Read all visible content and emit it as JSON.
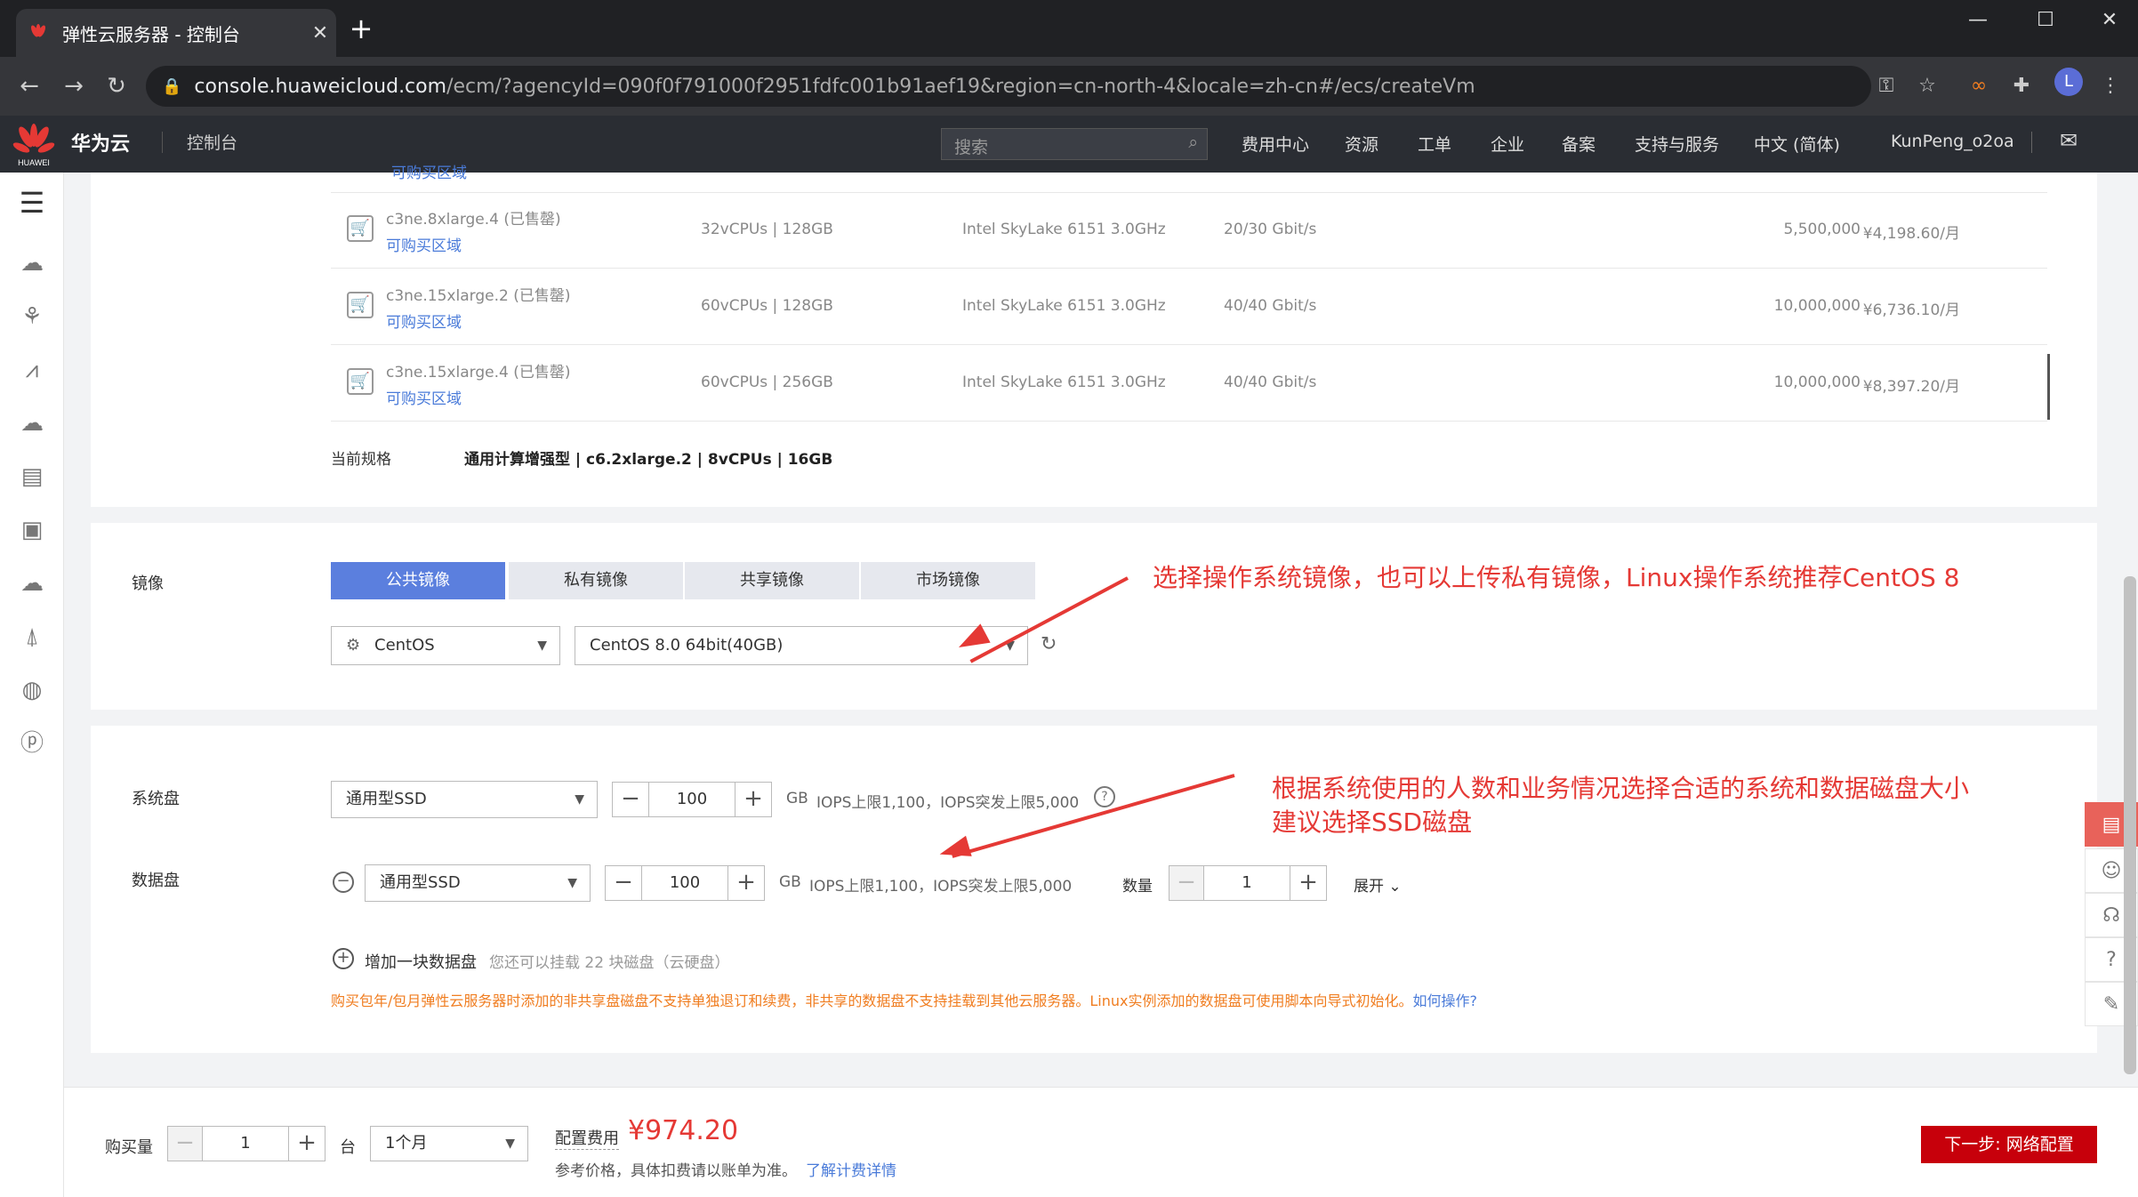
{
  "browser": {
    "tab_title": "弹性云服务器 - 控制台",
    "url_host": "console.huaweicloud.com",
    "url_path": "/ecm/?agencyId=090f0f791000f2951fdfc001b91aef19&region=cn-north-4&locale=zh-cn#/ecs/createVm",
    "avatar": "L"
  },
  "header": {
    "brand": "华为云",
    "logo_text": "HUAWEI",
    "console": "控制台",
    "search_placeholder": "搜索",
    "nav": [
      "费用中心",
      "资源",
      "工单",
      "企业",
      "备案",
      "支持与服务",
      "中文 (简体)",
      "KunPeng_o2oa"
    ]
  },
  "flavors": {
    "rows": [
      {
        "name": "c3ne.8xlarge.4 (已售罄)",
        "link": "可购买区域",
        "cpu_mem": "32vCPUs | 128GB",
        "cpu": "Intel SkyLake 6151 3.0GHz",
        "net": "20/30 Gbit/s",
        "pps": "5,500,000",
        "price": "¥4,198.60/月"
      },
      {
        "name": "c3ne.15xlarge.2 (已售罄)",
        "link": "可购买区域",
        "cpu_mem": "60vCPUs | 128GB",
        "cpu": "Intel SkyLake 6151 3.0GHz",
        "net": "40/40 Gbit/s",
        "pps": "10,000,000",
        "price": "¥6,736.10/月"
      },
      {
        "name": "c3ne.15xlarge.4 (已售罄)",
        "link": "可购买区域",
        "cpu_mem": "60vCPUs | 256GB",
        "cpu": "Intel SkyLake 6151 3.0GHz",
        "net": "40/40 Gbit/s",
        "pps": "10,000,000",
        "price": "¥8,397.20/月"
      }
    ],
    "partial_link": "可购买区域",
    "current_label": "当前规格",
    "current_value": "通用计算增强型 | c6.2xlarge.2 | 8vCPUs | 16GB"
  },
  "image": {
    "label": "镜像",
    "tabs": [
      "公共镜像",
      "私有镜像",
      "共享镜像",
      "市场镜像"
    ],
    "os": "CentOS",
    "version": "CentOS 8.0 64bit(40GB)",
    "note": "选择操作系统镜像，也可以上传私有镜像，Linux操作系统推荐CentOS 8"
  },
  "disk": {
    "sys_label": "系统盘",
    "sys_type": "通用型SSD",
    "sys_size": "100",
    "sys_unit": "GB",
    "sys_iops": "IOPS上限1,100，IOPS突发上限5,000",
    "data_label": "数据盘",
    "data_type": "通用型SSD",
    "data_size": "100",
    "data_unit": "GB",
    "data_iops": "IOPS上限1,100，IOPS突发上限5,000",
    "qty_label": "数量",
    "qty": "1",
    "expand": "展开",
    "add_label": "增加一块数据盘",
    "add_hint": "您还可以挂载 22 块磁盘（云硬盘）",
    "warning": "购买包年/包月弹性云服务器时添加的非共享盘磁盘不支持单独退订和续费，非共享的数据盘不支持挂载到其他云服务器。Linux实例添加的数据盘可使用脚本向导式初始化。",
    "warning_link": "如何操作?",
    "note_line1": "根据系统使用的人数和业务情况选择合适的系统和数据磁盘大小",
    "note_line2": "建议选择SSD磁盘"
  },
  "footer": {
    "qty_label": "购买量",
    "qty": "1",
    "unit": "台",
    "period": "1个月",
    "fee_label": "配置费用",
    "fee": "¥974.20",
    "ref": "参考价格，具体扣费请以账单为准。",
    "ref_link": "了解计费详情",
    "next": "下一步: 网络配置"
  },
  "colors": {
    "accent": "#5b7fde",
    "brand_red": "#c7000b",
    "note_red": "#e53935"
  }
}
